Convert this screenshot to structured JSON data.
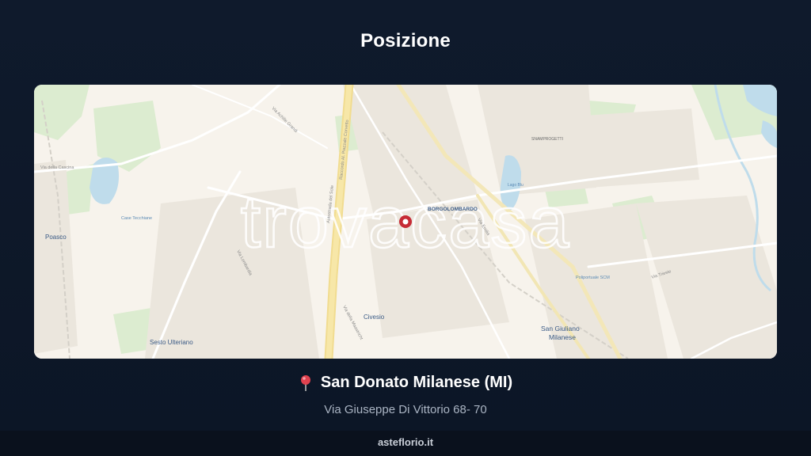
{
  "header": {
    "title": "Posizione"
  },
  "map": {
    "watermark": "trovacasa",
    "marker_color": "#c62b35",
    "labels": {
      "poasco": "Poasco",
      "sesto_ulteriano": "Sesto Ulteriano",
      "civesio": "Civesio",
      "borgolombardo": "BORGOLOMBARDO",
      "san_giuliano_1": "San Giuliano",
      "san_giuliano_2": "Milanese",
      "case_tecchiane": "Case Tecchiane",
      "lago_blu": "Lago Blu",
      "snamprogetti": "SNAMPROGETTI",
      "poliportuale": "Poliportuale SCM"
    },
    "streets": {
      "via_della_cascina": "Via della Cascina",
      "via_achille_grandi": "Via Achille Grandi",
      "autostrada_del_sole": "Autostrada del Sole",
      "raccordo": "Raccordo Al. Piazzale Corvetto",
      "via_lombardia": "Via Lombardia",
      "via_emilia": "Via Emilia",
      "via_maastricht": "Via della Maastricht",
      "via_trieste": "Via Trieste"
    }
  },
  "location": {
    "pin_icon": "round-pushpin",
    "city": "San Donato Milanese (MI)",
    "address": "Via Giuseppe Di Vittorio 68- 70"
  },
  "footer": {
    "site": "asteflorio.it"
  }
}
